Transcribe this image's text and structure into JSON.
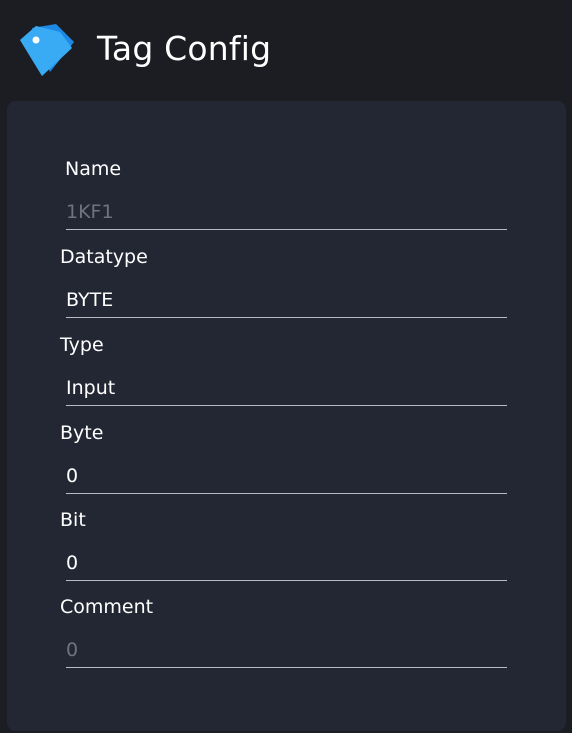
{
  "header": {
    "title": "Tag Config",
    "logo_icon": "tag-icon",
    "accent": "#1e88e5"
  },
  "form": {
    "name": {
      "label": "Name",
      "value": "1KF1",
      "readonly": true
    },
    "datatype": {
      "label": "Datatype",
      "value": "BYTE"
    },
    "type": {
      "label": "Type",
      "value": "Input"
    },
    "byte": {
      "label": "Byte",
      "value": "0"
    },
    "bit": {
      "label": "Bit",
      "value": "0"
    },
    "comment": {
      "label": "Comment",
      "value": "0",
      "placeholder": true
    }
  }
}
